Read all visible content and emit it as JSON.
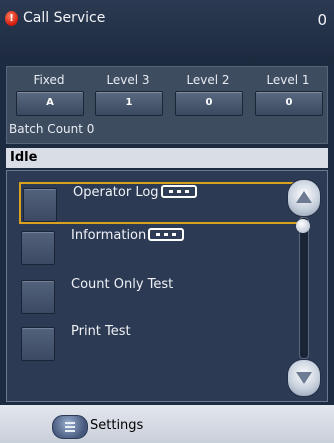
{
  "topbar": {
    "alert_label": "Call Service",
    "alert_count": "0",
    "alert_icon": "exclamation-icon"
  },
  "counters": {
    "headers": [
      "Fixed",
      "Level 3",
      "Level 2",
      "Level 1"
    ],
    "values": [
      "A",
      "1",
      "0",
      "0"
    ],
    "batch_count": "Batch Count 0"
  },
  "status": "Idle",
  "menu": {
    "items": [
      {
        "label": "Operator Log",
        "has_more": true,
        "selected": true
      },
      {
        "label": "Information",
        "has_more": true,
        "selected": false
      },
      {
        "label": "Count Only Test",
        "has_more": false,
        "selected": false
      },
      {
        "label": "Print Test",
        "has_more": false,
        "selected": false
      }
    ],
    "selection_color": "#d8a21e"
  },
  "bottom": {
    "settings_label": "Settings",
    "settings_icon": "list-icon"
  }
}
